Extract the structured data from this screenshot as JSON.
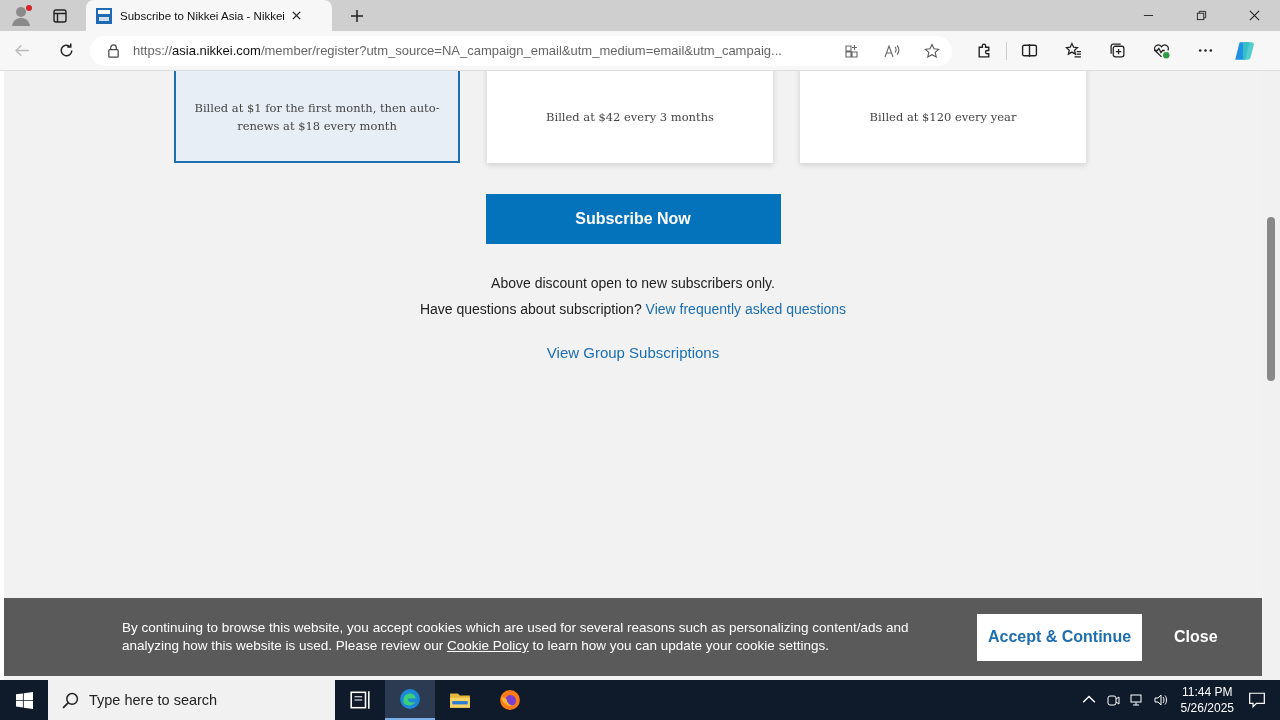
{
  "browser": {
    "tab_title": "Subscribe to Nikkei Asia - Nikkei",
    "url": {
      "scheme": "https://",
      "host": "asia.nikkei.com",
      "path": "/member/register?utm_source=NA_campaign_email&utm_medium=email&utm_campaig..."
    }
  },
  "plans": [
    {
      "text": "Billed at $1 for the first month, then auto-renews at $18 every month",
      "selected": true
    },
    {
      "text": "Billed at $42 every 3 months",
      "selected": false
    },
    {
      "text": "Billed at $120 every year",
      "selected": false
    }
  ],
  "subscribe_button": "Subscribe Now",
  "note": "Above discount open to new subscribers only.",
  "faq": {
    "question": "Have questions about subscription?",
    "link": "View frequently asked questions"
  },
  "group_link": "View Group Subscriptions",
  "cookie_banner": {
    "text_before": "By continuing to browse this website, you accept cookies which are used for several reasons such as personalizing content/ads and analyzing how this website is used. Please review our",
    "link": "Cookie Policy",
    "text_after": "to learn how you can update your cookie settings.",
    "accept": "Accept & Continue",
    "close": "Close"
  },
  "taskbar": {
    "search_placeholder": "Type here to search",
    "time": "11:44 PM",
    "date": "5/26/2025"
  }
}
